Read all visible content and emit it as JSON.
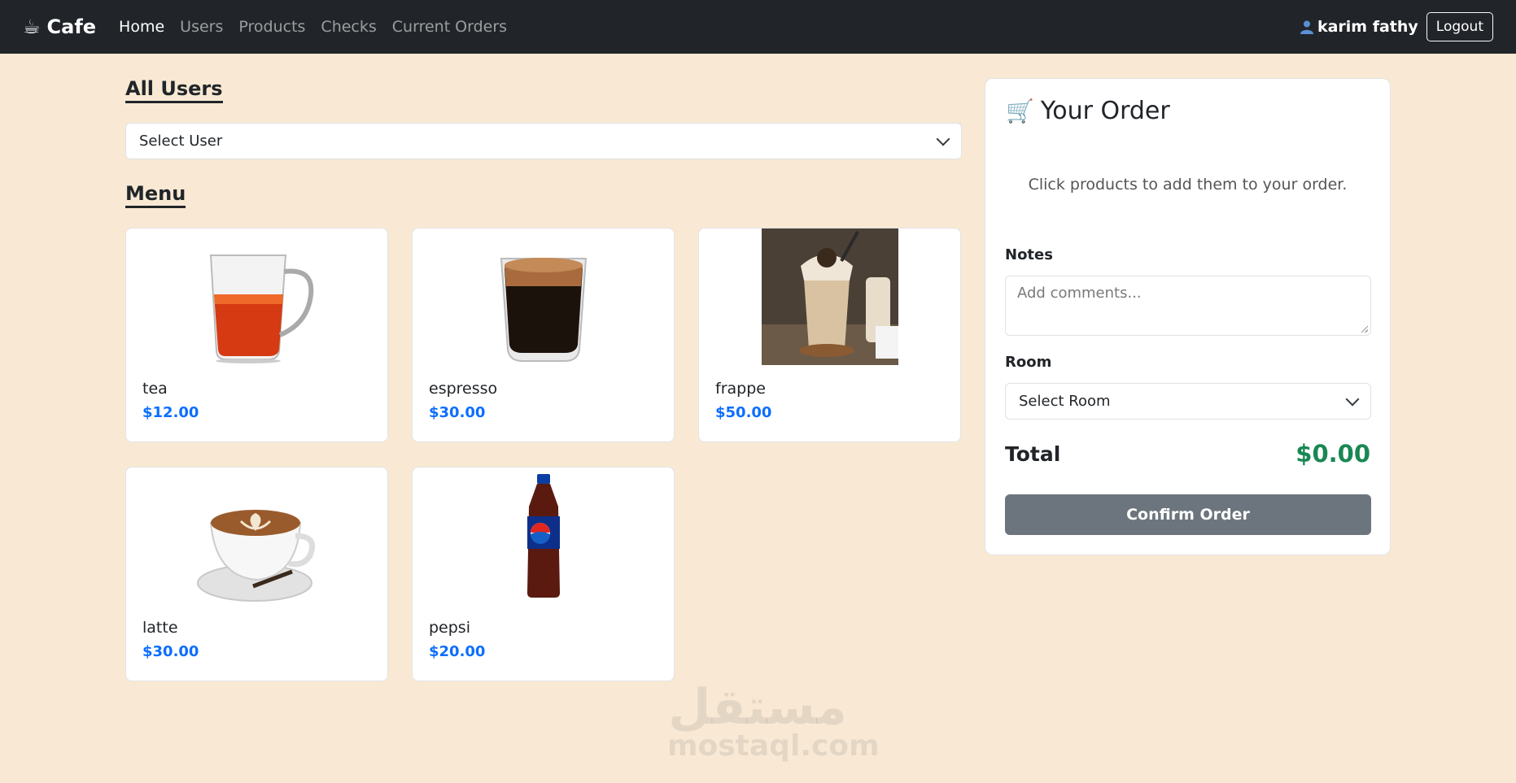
{
  "navbar": {
    "brand": "Cafe",
    "brand_icon": "coffee-cup-icon",
    "links": [
      {
        "label": "Home",
        "active": true
      },
      {
        "label": "Users",
        "active": false
      },
      {
        "label": "Products",
        "active": false
      },
      {
        "label": "Checks",
        "active": false
      },
      {
        "label": "Current Orders",
        "active": false
      }
    ],
    "user_icon": "person-icon",
    "user_name": "karim fathy",
    "logout_label": "Logout"
  },
  "users": {
    "title": "All Users",
    "select_value": "Select User"
  },
  "menu": {
    "title": "Menu",
    "products": [
      {
        "name": "tea",
        "price": "$12.00",
        "image": "tea-glass"
      },
      {
        "name": "espresso",
        "price": "$30.00",
        "image": "espresso-glass"
      },
      {
        "name": "frappe",
        "price": "$50.00",
        "image": "frappe-photo"
      },
      {
        "name": "latte",
        "price": "$30.00",
        "image": "latte-cup"
      },
      {
        "name": "pepsi",
        "price": "$20.00",
        "image": "pepsi-bottle"
      }
    ]
  },
  "order": {
    "title": "Your Order",
    "title_icon": "shopping-cart-icon",
    "hint": "Click products to add them to your order.",
    "notes_label": "Notes",
    "notes_placeholder": "Add comments...",
    "room_label": "Room",
    "room_value": "Select Room",
    "total_label": "Total",
    "total_value": "$0.00",
    "confirm_label": "Confirm Order"
  },
  "watermark": {
    "arabic": "مستقل",
    "latin": "mostaql.com"
  },
  "colors": {
    "background": "#f9e9d4",
    "navbar": "#212529",
    "price": "#0d6efd",
    "total": "#198754",
    "confirm_button": "#6c757d"
  }
}
